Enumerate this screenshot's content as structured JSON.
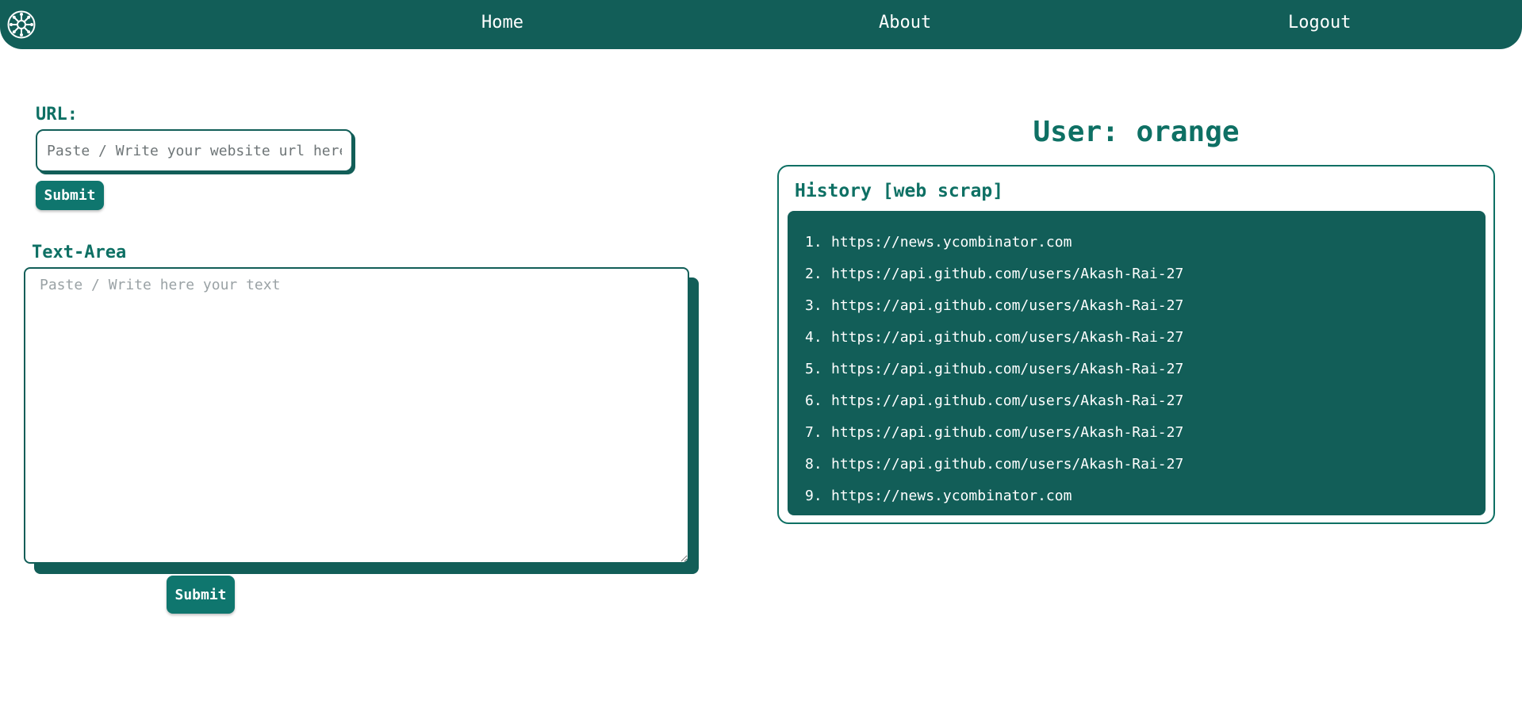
{
  "nav": {
    "logo_icon": "snowflake-wheel-icon",
    "links": [
      {
        "label": "Home"
      },
      {
        "label": "About"
      },
      {
        "label": "Logout"
      }
    ]
  },
  "url_form": {
    "label": "URL:",
    "placeholder": "Paste / Write your website url here",
    "value": "",
    "submit_label": "Submit"
  },
  "text_form": {
    "label": "Text-Area",
    "placeholder": "Paste / Write here your text",
    "value": "",
    "submit_label": "Submit"
  },
  "user": {
    "title": "User: orange"
  },
  "history": {
    "heading": "History [web scrap]",
    "items": [
      {
        "num": "1.",
        "url": "https://news.ycombinator.com"
      },
      {
        "num": "2.",
        "url": "https://api.github.com/users/Akash-Rai-27"
      },
      {
        "num": "3.",
        "url": "https://api.github.com/users/Akash-Rai-27"
      },
      {
        "num": "4.",
        "url": "https://api.github.com/users/Akash-Rai-27"
      },
      {
        "num": "5.",
        "url": "https://api.github.com/users/Akash-Rai-27"
      },
      {
        "num": "6.",
        "url": "https://api.github.com/users/Akash-Rai-27"
      },
      {
        "num": "7.",
        "url": "https://api.github.com/users/Akash-Rai-27"
      },
      {
        "num": "8.",
        "url": "https://api.github.com/users/Akash-Rai-27"
      },
      {
        "num": "9.",
        "url": "https://news.ycombinator.com"
      }
    ]
  },
  "colors": {
    "primary": "#125e58",
    "accent_text": "#0e7064",
    "button": "#0f766e",
    "background": "#ffffff"
  }
}
